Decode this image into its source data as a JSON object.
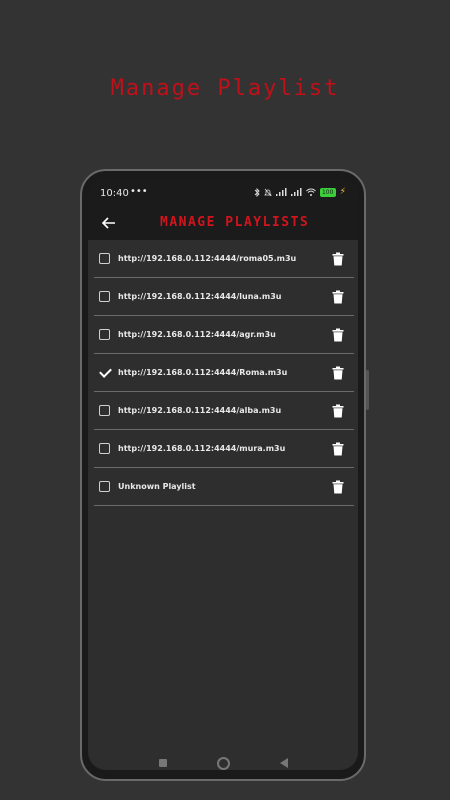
{
  "promo": {
    "title": "Manage Playlist"
  },
  "status": {
    "time": "10:40",
    "dots": "•••",
    "battery": "100"
  },
  "appbar": {
    "title": "MANAGE PLAYLISTS"
  },
  "playlists": [
    {
      "label": "http://192.168.0.112:4444/roma05.m3u",
      "checked": false
    },
    {
      "label": "http://192.168.0.112:4444/luna.m3u",
      "checked": false
    },
    {
      "label": "http://192.168.0.112:4444/agr.m3u",
      "checked": false
    },
    {
      "label": "http://192.168.0.112:4444/Roma.m3u",
      "checked": true
    },
    {
      "label": "http://192.168.0.112:4444/alba.m3u",
      "checked": false
    },
    {
      "label": "http://192.168.0.112:4444/mura.m3u",
      "checked": false
    },
    {
      "label": "Unknown Playlist",
      "checked": false
    }
  ],
  "colors": {
    "accent": "#d1141d",
    "background": "#333333",
    "screen": "#2e2e2e"
  }
}
